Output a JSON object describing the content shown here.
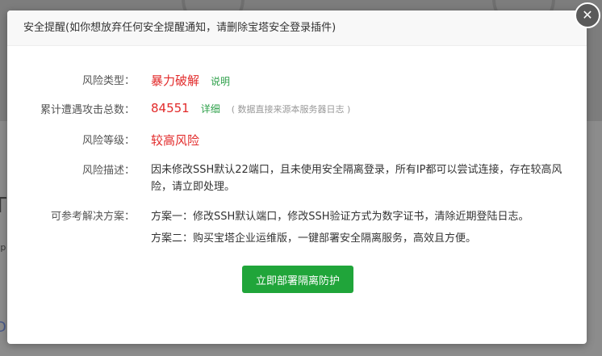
{
  "dialog": {
    "title": "安全提醒(如你想放弃任何安全提醒通知，请删除宝塔安全登录插件)",
    "close_glyph": "✕"
  },
  "fields": {
    "risk_type": {
      "label": "风险类型：",
      "value": "暴力破解",
      "link": "说明"
    },
    "attack_count": {
      "label": "累计遭遇攻击总数：",
      "value": "84551",
      "link": "详细",
      "note": "( 数据直接来源本服务器日志 )"
    },
    "risk_level": {
      "label": "风险等级：",
      "value": "较高风险"
    },
    "risk_desc": {
      "label": "风险描述：",
      "value": "因未修改SSH默认22端口，且未使用安全隔离登录，所有IP都可以尝试连接，存在较高风险，请立即处理。"
    },
    "solutions": {
      "label": "可参考解决方案：",
      "items": [
        "方案一：修改SSH默认端口，修改SSH验证方式为数字证书，清除近期登陆日志。",
        "方案二：购买宝塔企业运维版，一键部署安全隔离服务，高效且方便。"
      ]
    }
  },
  "action_button": "立即部署隔离防护",
  "background": {
    "glyph_left": "T",
    "glyph_left2": "tp",
    "glyph_bottom": "D"
  },
  "colors": {
    "accent_green": "#20a53a",
    "danger_red": "#e22a2a",
    "link_green": "#2ea04a"
  }
}
